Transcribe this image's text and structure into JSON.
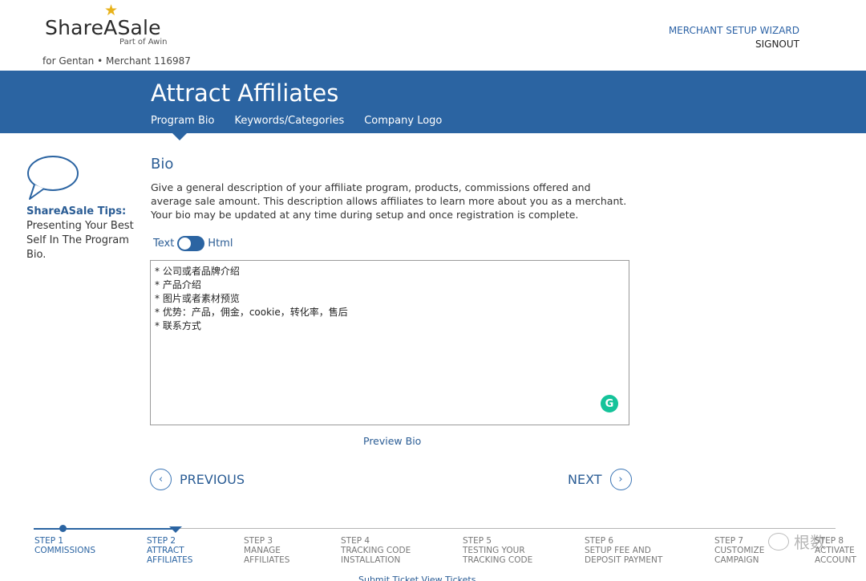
{
  "header": {
    "logo_name": "ShareASale",
    "logo_sub": "Part of Awin",
    "merchant_line": "for Gentan • Merchant 116987",
    "links": {
      "wizard": "MERCHANT SETUP WIZARD",
      "signout": "SIGNOUT"
    }
  },
  "banner": {
    "title": "Attract Affiliates",
    "tabs": [
      "Program Bio",
      "Keywords/Categories",
      "Company Logo"
    ]
  },
  "tips": {
    "title": "ShareASale Tips:",
    "text": "Presenting Your Best Self In The Program Bio."
  },
  "bio": {
    "title": "Bio",
    "description": "Give a general description of your affiliate program, products, commissions offered and average sale amount. This description allows affiliates to learn more about you as a merchant. Your bio may be updated at any time during setup and once registration is complete.",
    "toggle_left": "Text",
    "toggle_right": "Html",
    "editor_lines": [
      "* 公司或者品牌介绍",
      "* 产品介绍",
      "* 图片或者素材预览",
      "* 优势：产品，佣金，cookie，转化率，售后",
      "* 联系方式"
    ],
    "grammarly_glyph": "G",
    "preview_label": "Preview Bio"
  },
  "nav": {
    "previous": "PREVIOUS",
    "next": "NEXT",
    "prev_glyph": "‹",
    "next_glyph": "›"
  },
  "steps": [
    {
      "num": "STEP 1",
      "label": "COMMISSIONS"
    },
    {
      "num": "STEP 2",
      "label": "ATTRACT AFFILIATES"
    },
    {
      "num": "STEP 3",
      "label": "MANAGE AFFILIATES"
    },
    {
      "num": "STEP 4",
      "label": "TRACKING CODE INSTALLATION"
    },
    {
      "num": "STEP 5",
      "label": "TESTING YOUR TRACKING CODE"
    },
    {
      "num": "STEP 6",
      "label": "SETUP FEE AND DEPOSIT PAYMENT"
    },
    {
      "num": "STEP 7",
      "label": "CUSTOMIZE CAMPAIGN"
    },
    {
      "num": "STEP 8",
      "label": "ACTIVATE ACCOUNT"
    }
  ],
  "bottom_links": "Submit Ticket   View Tickets",
  "watermark": "根数",
  "colors": {
    "brand_blue": "#2b64a2",
    "link_blue": "#2b5d95",
    "star": "#e8b21a",
    "grammarly": "#15c39a"
  }
}
